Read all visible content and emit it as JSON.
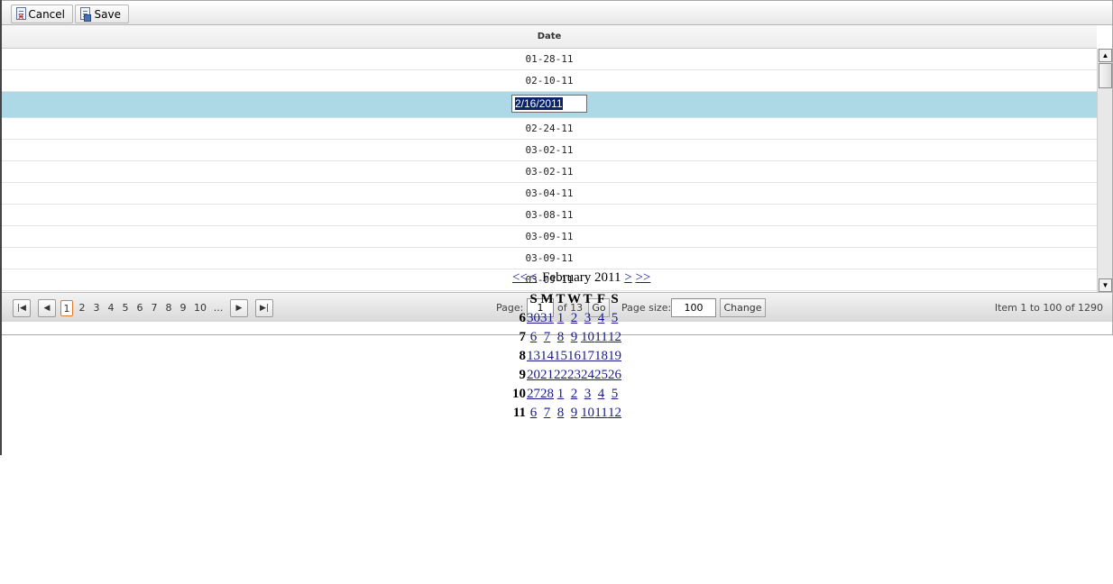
{
  "toolbar": {
    "cancel_label": "Cancel",
    "save_label": "Save"
  },
  "grid": {
    "column_header": "Date",
    "rows": [
      "01-28-11",
      "02-10-11",
      "",
      "02-24-11",
      "03-02-11",
      "03-02-11",
      "03-04-11",
      "03-08-11",
      "03-09-11",
      "03-09-11",
      "03-09-11"
    ],
    "editor_value": "2/16/2011"
  },
  "pager": {
    "pages": [
      "1",
      "2",
      "3",
      "4",
      "5",
      "6",
      "7",
      "8",
      "9",
      "10",
      "..."
    ],
    "current_page": "1",
    "page_label": "Page:",
    "page_value": "1",
    "of_label": "of 13",
    "go_label": "Go",
    "page_size_label": "Page size:",
    "page_size_value": "100",
    "change_label": "Change",
    "item_text": "Item 1 to 100 of 1290"
  },
  "calendar": {
    "prev_year": "<<",
    "prev_month": "<",
    "month_title": "February 2011",
    "next_month": ">",
    "next_year": ">>",
    "day_headers": [
      "S",
      "M",
      "T",
      "W",
      "T",
      "F",
      "S"
    ],
    "weeks": [
      {
        "wk": "6",
        "days": [
          "30",
          "31",
          "1",
          "2",
          "3",
          "4",
          "5"
        ]
      },
      {
        "wk": "7",
        "days": [
          "6",
          "7",
          "8",
          "9",
          "10",
          "11",
          "12"
        ]
      },
      {
        "wk": "8",
        "days": [
          "13",
          "14",
          "15",
          "16",
          "17",
          "18",
          "19"
        ]
      },
      {
        "wk": "9",
        "days": [
          "20",
          "21",
          "22",
          "23",
          "24",
          "25",
          "26"
        ]
      },
      {
        "wk": "10",
        "days": [
          "27",
          "28",
          "1",
          "2",
          "3",
          "4",
          "5"
        ]
      },
      {
        "wk": "11",
        "days": [
          "6",
          "7",
          "8",
          "9",
          "10",
          "11",
          "12"
        ]
      }
    ]
  }
}
